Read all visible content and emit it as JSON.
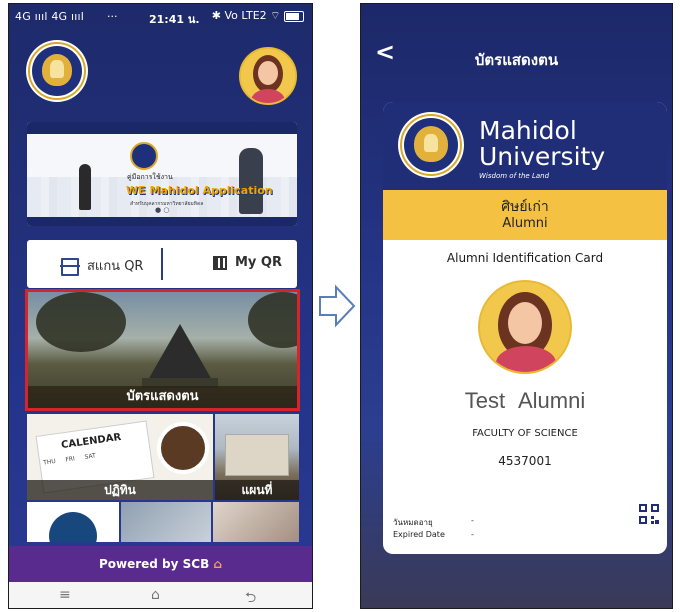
{
  "phone1": {
    "status": {
      "network": "4G ıııl 4G ıııl",
      "extras": "···",
      "time": "21:41 น.",
      "right": "✱ Vo LTE2 ⌔"
    },
    "banner": {
      "line1": "คู่มือการใช้งาน",
      "line2": "WE Mahidol Application",
      "line3": "สำหรับบุคลากรมหาวิทยาลัยมหิดล"
    },
    "qr_bar": {
      "scan_label": "สแกน QR",
      "myqr_label": "My QR"
    },
    "tiles": {
      "id_card": "บัตรแสดงตน",
      "calendar_caption": "ปฏิทิน",
      "calendar_word": "CALENDAR",
      "calendar_days": "THU FRI SAT",
      "map": "แผนที่"
    },
    "powered_by": "Powered by SCB",
    "navbar": {
      "menu": "≡",
      "home": "⌂",
      "back": "⮌"
    }
  },
  "phone2": {
    "title": "บัตรแสดงตน",
    "back": "<",
    "card": {
      "university_line1": "Mahidol",
      "university_line2": "University",
      "tagline": "Wisdom of the Land",
      "status_th": "ศิษย์เก่า",
      "status_en": "Alumni",
      "card_title": "Alumni Identification Card",
      "name": "Test Alumni",
      "faculty": "FACULTY OF SCIENCE",
      "id_number": "4537001",
      "expire_th": "วันหมดอายุ",
      "expire_en": "Expired Date",
      "expire_value_th": "-",
      "expire_value_en": "-"
    }
  },
  "colors": {
    "navy": "#1f2e76",
    "gold": "#f5c142",
    "scb_purple": "#5a2b8f",
    "highlight_red": "#d7232a"
  }
}
